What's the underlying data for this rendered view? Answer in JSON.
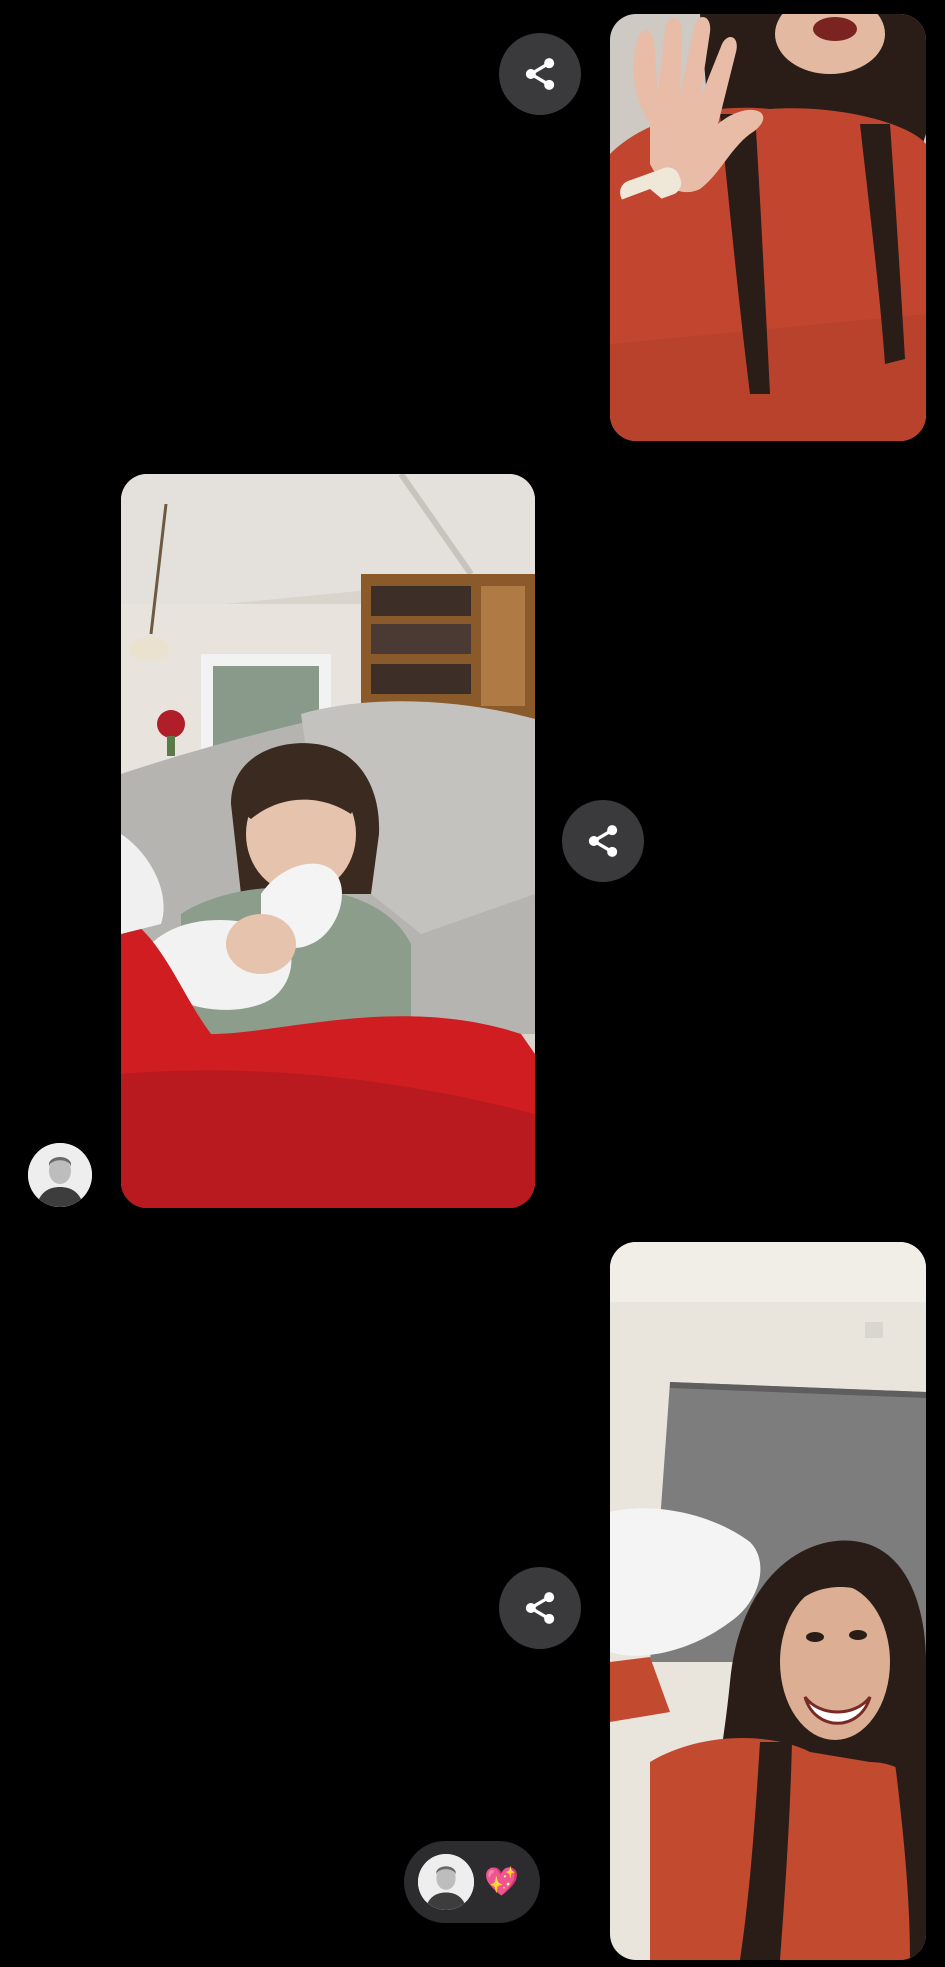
{
  "colors": {
    "background": "#000000",
    "share_button_bg": "#3a3a3c",
    "reaction_pill_bg": "#2c2c2e"
  },
  "messages": [
    {
      "id": 1,
      "side": "right",
      "content": "photo-woman-waving",
      "share_icon": "share-icon"
    },
    {
      "id": 2,
      "side": "left",
      "content": "photo-child-on-couch",
      "share_icon": "share-icon",
      "sender_avatar": "avatar"
    },
    {
      "id": 3,
      "side": "right",
      "content": "photo-woman-grimacing",
      "share_icon": "share-icon"
    }
  ],
  "reaction": {
    "avatar": "avatar",
    "emoji": "💖"
  }
}
